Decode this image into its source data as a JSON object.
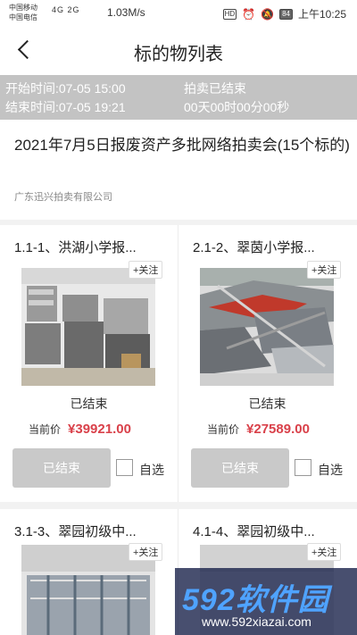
{
  "statusbar": {
    "carrier1": "中国移动",
    "carrier2": "中国电信",
    "signal": "4G  2G",
    "net_speed": "1.03M/s",
    "hd": "HD",
    "battery": "84",
    "time": "上午10:25"
  },
  "nav": {
    "title": "标的物列表"
  },
  "timeband": {
    "start": "开始时间:07-05 15:00",
    "end": "结束时间:07-05 19:21",
    "state": "拍卖已结束",
    "countdown": "00天00时00分00秒"
  },
  "auction": {
    "title": "2021年7月5日报废资产多批网络拍卖会(15个标的)",
    "org": "广东迅兴拍卖有限公司"
  },
  "lots": [
    {
      "title": "1.1-1、洪湖小学报...",
      "follow": "+关注",
      "status": "已结束",
      "price_label": "当前价",
      "price": "¥39921.00",
      "button": "已结束",
      "checkbox_label": "自选"
    },
    {
      "title": "2.1-2、翠茵小学报...",
      "follow": "+关注",
      "status": "已结束",
      "price_label": "当前价",
      "price": "¥27589.00",
      "button": "已结束",
      "checkbox_label": "自选"
    },
    {
      "title": "3.1-3、翠园初级中...",
      "follow": "+关注"
    },
    {
      "title": "4.1-4、翠园初级中...",
      "follow": "+关注"
    }
  ],
  "watermark": {
    "main": "592软件园",
    "sub": "www.592xiazai.com"
  },
  "colors": {
    "price": "#d9414a",
    "timeband": "#c3c3c3",
    "button_disabled": "#c9c9c9"
  }
}
